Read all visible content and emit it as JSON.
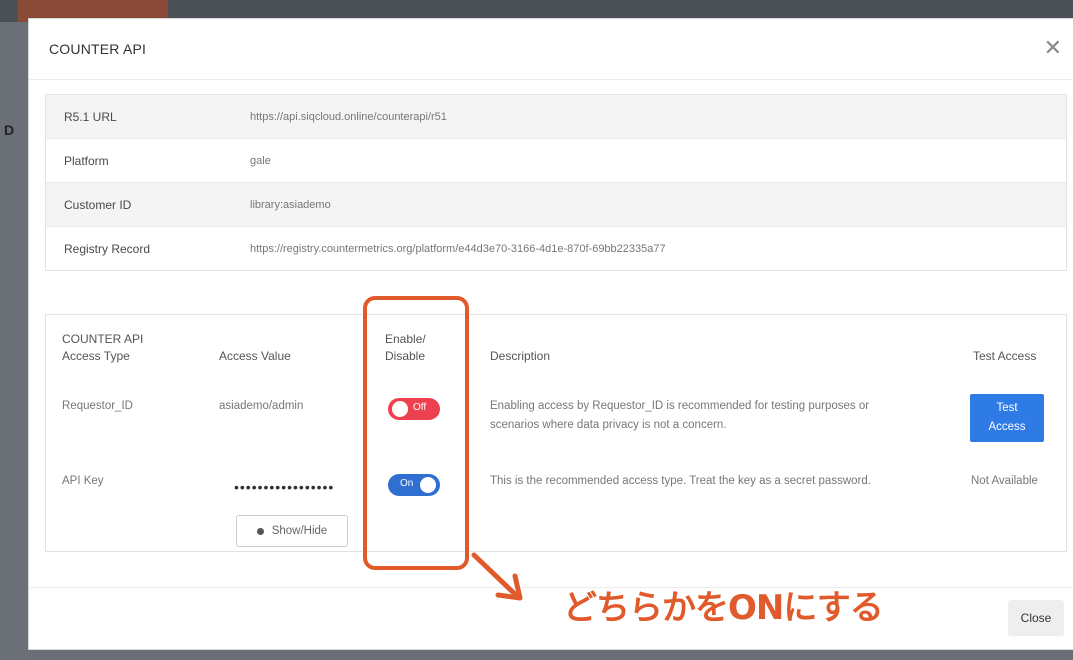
{
  "modal": {
    "title": "COUNTER API",
    "close_icon": "close-icon",
    "close_button": "Close"
  },
  "info": [
    {
      "label": "R5.1 URL",
      "value": "https://api.siqcloud.online/counterapi/r51"
    },
    {
      "label": "Platform",
      "value": "gale"
    },
    {
      "label": "Customer ID",
      "value": "library:asiademo"
    },
    {
      "label": "Registry Record",
      "value": "https://registry.countermetrics.org/platform/e44d3e70-3166-4d1e-870f-69bb22335a77"
    }
  ],
  "access": {
    "headers": {
      "type_line1": "COUNTER API",
      "type_line2": "Access Type",
      "value": "Access Value",
      "enable_line1": "Enable/",
      "enable_line2": "Disable",
      "description": "Description",
      "test": "Test Access"
    },
    "rows": [
      {
        "type": "Requestor_ID",
        "value": "asiademo/admin",
        "toggle": "Off",
        "description_line1": "Enabling access by Requestor_ID is recommended for testing purposes or",
        "description_line2": "scenarios where data privacy is not a concern.",
        "test_line1": "Test",
        "test_line2": "Access"
      },
      {
        "type": "API Key",
        "value": "•••••••••••••••••",
        "show_hide": "Show/Hide",
        "toggle": "On",
        "description_line1": "This is the recommended access type. Treat the key as a secret password.",
        "test": "Not Available"
      }
    ]
  },
  "annotation": {
    "text": "どちらかをONにする",
    "color": "#e05a2b"
  },
  "colors": {
    "toggle_off": "#ee4150",
    "toggle_on": "#2f6fd1",
    "test_button": "#2f7be5"
  }
}
